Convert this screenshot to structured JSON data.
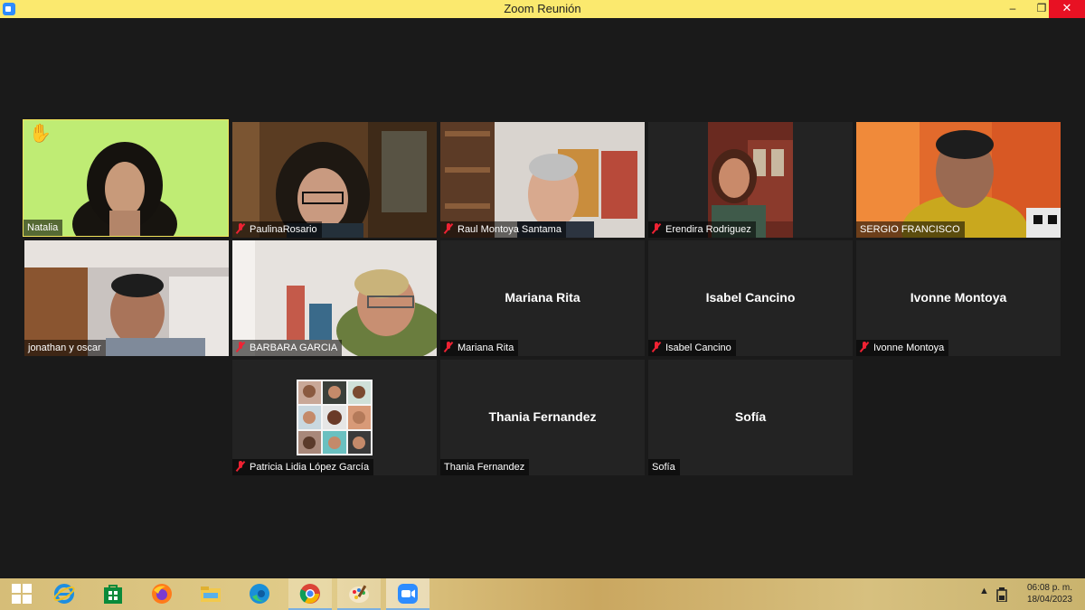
{
  "window": {
    "title": "Zoom Reunión",
    "minimize_glyph": "–",
    "restore_glyph": "❐",
    "close_glyph": "✕"
  },
  "participants": [
    {
      "name": "Natalia",
      "muted": false,
      "video": true,
      "hand_raised": true,
      "active_speaker": true,
      "hand_icon": "✋"
    },
    {
      "name": "PaulinaRosario",
      "muted": true,
      "video": true
    },
    {
      "name": "Raul Montoya Santama",
      "muted": true,
      "video": true
    },
    {
      "name": "Erendira Rodriguez",
      "muted": true,
      "video": true
    },
    {
      "name": "SERGIO FRANCISCO",
      "muted": false,
      "video": true
    },
    {
      "name": "jonathan y oscar",
      "muted": false,
      "video": true
    },
    {
      "name": "BARBARA GARCIA",
      "muted": true,
      "video": true
    },
    {
      "name": "Mariana Rita",
      "muted": true,
      "video": false
    },
    {
      "name": "Isabel Cancino",
      "muted": true,
      "video": false
    },
    {
      "name": "Ivonne Montoya",
      "muted": true,
      "video": false
    },
    {
      "name": "Patricia Lidia López García",
      "muted": true,
      "video": false,
      "profile_photo": true
    },
    {
      "name": "Thania Fernandez",
      "muted": false,
      "video": false
    },
    {
      "name": "Sofía",
      "muted": false,
      "video": false
    }
  ],
  "taskbar": {
    "apps": [
      "windows-start-icon",
      "internet-explorer-icon",
      "store-icon",
      "firefox-icon",
      "file-explorer-icon",
      "edge-icon",
      "chrome-icon",
      "paint-icon",
      "zoom-icon"
    ],
    "time": "06:08 p. m.",
    "date": "18/04/2023",
    "tray_chevron": "▲"
  },
  "colors": {
    "title_bar": "#fbe96e",
    "active_speaker_border": "#f2e35a",
    "mute_red": "#e22233",
    "close_red": "#e81123"
  }
}
